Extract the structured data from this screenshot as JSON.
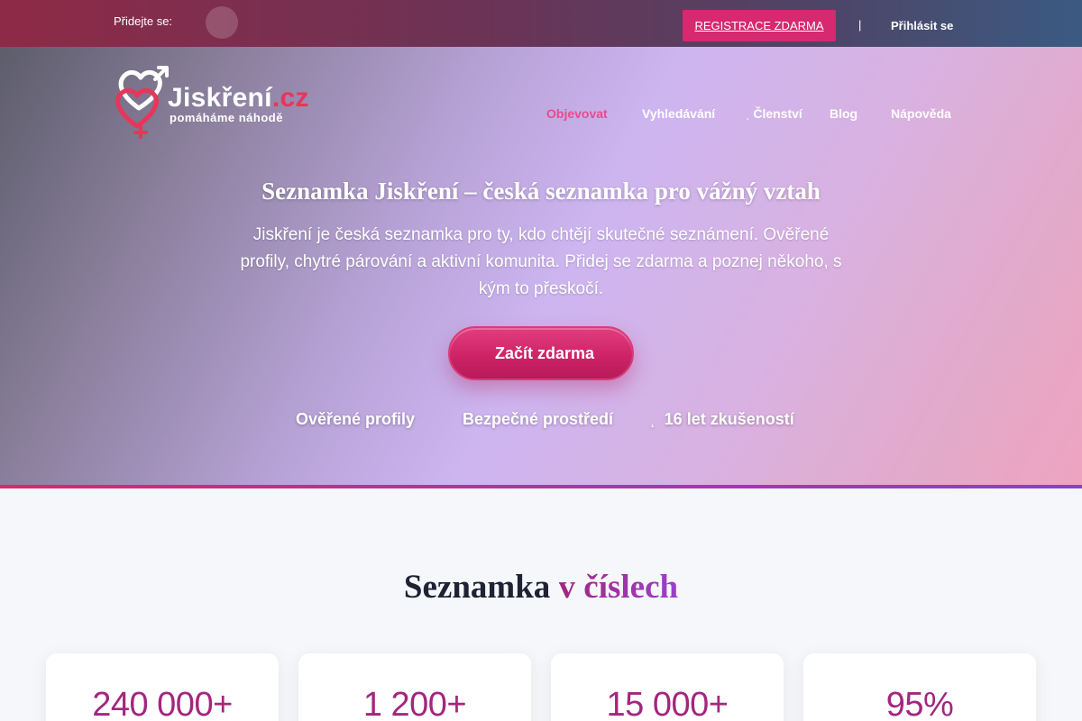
{
  "topbar": {
    "join_label": "Přidejte se:",
    "join_icon": "",
    "social_icon": "",
    "register_label": "REGISTRACE ZDARMA",
    "separator": "|",
    "login_label": "Přihlásit se"
  },
  "logo": {
    "name": "Jiskření",
    "domain": ".cz",
    "tagline": "pomáháme náhodě"
  },
  "nav": {
    "items": [
      {
        "icon": "",
        "label": "Objevovat",
        "active": true
      },
      {
        "icon": "",
        "label": "Vyhledávání",
        "active": false
      },
      {
        "icon": "˛",
        "label": "Členství",
        "active": false
      },
      {
        "icon": "",
        "label": "Blog",
        "active": false
      },
      {
        "icon": "",
        "label": "Nápověda",
        "active": false
      }
    ]
  },
  "hero": {
    "title": "Seznamka Jiskření – česká seznamka pro vážný vztah",
    "description": "Jiskření je česká seznamka pro ty, kdo chtějí skutečné seznámení. Ověřené profily, chytré párování a aktivní komunita. Přidej se zdarma a poznej někoho, s kým to přeskočí.",
    "cta_icon": "",
    "cta_label": "Začít zdarma",
    "features": [
      {
        "icon": "",
        "label": "Ověřené profily"
      },
      {
        "icon": "",
        "label": "Bezpečné prostředí"
      },
      {
        "icon": "˛",
        "label": "16 let zkušeností"
      }
    ]
  },
  "stats": {
    "title_main": "Seznamka",
    "title_accent": "v číslech",
    "values": [
      "240 000+",
      "1 200+",
      "15 000+",
      "95%"
    ]
  },
  "colors": {
    "brand_pink": "#d6296f",
    "accent_purple": "#a3267e",
    "nav_active": "#e94c8f"
  }
}
